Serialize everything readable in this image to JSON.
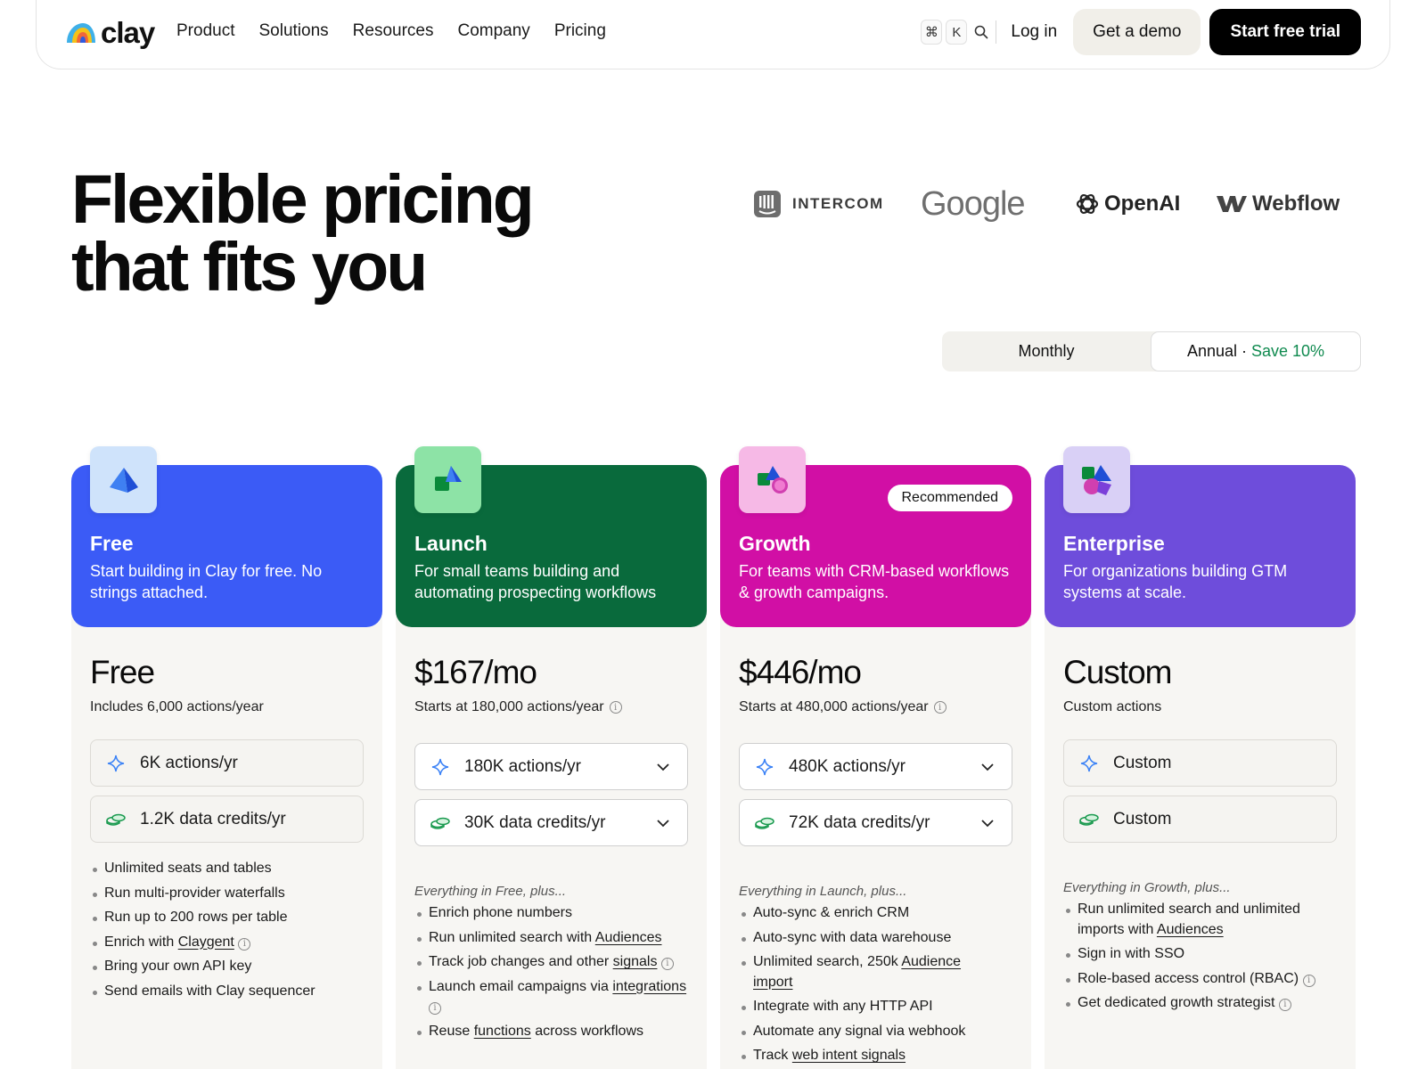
{
  "nav": {
    "logo": "clay",
    "links": [
      "Product",
      "Solutions",
      "Resources",
      "Company",
      "Pricing"
    ],
    "kbd_cmd": "⌘",
    "kbd_k": "K",
    "login": "Log in",
    "demo": "Get a demo",
    "trial": "Start free trial"
  },
  "hero": {
    "title_line1": "Flexible pricing",
    "title_line2": "that fits you"
  },
  "brands": {
    "intercom": "INTERCOM",
    "google": "Google",
    "openai": "OpenAI",
    "webflow": "Webflow"
  },
  "billing": {
    "monthly": "Monthly",
    "annual": "Annual",
    "separator": " · ",
    "save": "Save 10%",
    "selected": "Annual"
  },
  "plans": [
    {
      "name": "Free",
      "description": "Start building in Clay for free. No strings attached.",
      "price": "Free",
      "subtitle": "Includes 6,000 actions/year",
      "actions": "6K actions/yr",
      "credits": "1.2K data credits/yr",
      "color": "#3b5bf6",
      "icon_bg": "#cfe3fb",
      "features": [
        {
          "before": "Unlimited seats and tables"
        },
        {
          "before": "Run multi-provider waterfalls"
        },
        {
          "before": "Run up to 200 rows per table"
        },
        {
          "before": "Enrich with ",
          "link": "Claygent"
        },
        {
          "before": "Bring your own API key"
        },
        {
          "before": "Send emails with Clay sequencer"
        }
      ]
    },
    {
      "name": "Launch",
      "description": "For small teams building and automating prospecting workflows",
      "price": "$167/mo",
      "subtitle": "Starts at 180,000 actions/year",
      "actions": "180K actions/yr",
      "credits": "30K data credits/yr",
      "intro": "Everything in Free, plus...",
      "color": "#096a3c",
      "icon_bg": "#8de3a6",
      "features": [
        {
          "before": "Enrich phone numbers"
        },
        {
          "before": "Run unlimited search with ",
          "link": "Audiences"
        },
        {
          "before": "Track job changes and other ",
          "link": "signals"
        },
        {
          "before": "Launch email campaigns via ",
          "link": "integrations"
        },
        {
          "before": "Reuse ",
          "link": "functions",
          "after": " across workflows"
        }
      ]
    },
    {
      "name": "Growth",
      "description": "For teams with CRM-based workflows & growth campaigns.",
      "price": "$446/mo",
      "subtitle": "Starts at 480,000 actions/year",
      "actions": "480K actions/yr",
      "credits": "72K data credits/yr",
      "intro": "Everything in Launch, plus...",
      "badge": "Recommended",
      "color": "#d10fa5",
      "icon_bg": "#f6b9e6",
      "features": [
        {
          "before": "Auto-sync & enrich CRM"
        },
        {
          "before": "Auto-sync with data warehouse"
        },
        {
          "before": "Unlimited search, 250k ",
          "link": "Audience import"
        },
        {
          "before": "Integrate with any HTTP API"
        },
        {
          "before": "Automate any signal via webhook"
        },
        {
          "before": "Track ",
          "link": "web intent signals"
        }
      ]
    },
    {
      "name": "Enterprise",
      "description": "For organizations building GTM systems at scale.",
      "price": "Custom",
      "subtitle": "Custom actions",
      "actions": "Custom",
      "credits": "Custom",
      "intro": "Everything in Growth, plus...",
      "color": "#6e4ddb",
      "icon_bg": "#d9d0f6",
      "features": [
        {
          "before": "Run unlimited search and unlimited imports with ",
          "link": "Audiences"
        },
        {
          "before": "Sign in with SSO"
        },
        {
          "before": "Role-based access control (RBAC)"
        },
        {
          "before": "Get dedicated growth strategist"
        }
      ]
    }
  ]
}
